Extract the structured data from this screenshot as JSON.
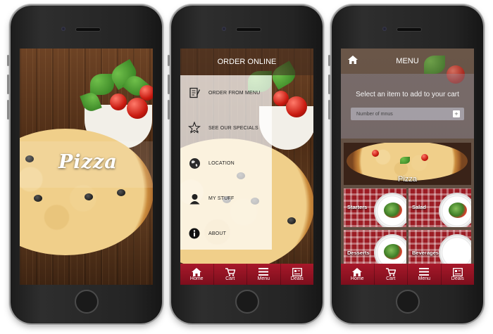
{
  "phone1": {
    "splash_title": "Pizza"
  },
  "phone2": {
    "header_title": "ORDER ONLINE",
    "menu_items": [
      {
        "label": "ORDER FROM MENU",
        "icon": "order-menu-icon"
      },
      {
        "label": "SEE OUR SPECIALS",
        "icon": "stars-icon"
      },
      {
        "label": "LOCATION",
        "icon": "globe-icon"
      },
      {
        "label": "MY STUFF",
        "icon": "user-icon"
      },
      {
        "label": "ABOUT",
        "icon": "info-icon"
      }
    ],
    "tabs": [
      {
        "label": "Home",
        "icon": "home-icon"
      },
      {
        "label": "Cart",
        "icon": "cart-icon"
      },
      {
        "label": "Menu",
        "icon": "hamburger-icon"
      },
      {
        "label": "Deals",
        "icon": "deals-icon"
      }
    ]
  },
  "phone3": {
    "header_title": "MENU",
    "prompt": "Select an item to add to your cart",
    "input_placeholder": "Number of mnus",
    "banner_label": "Pizza",
    "categories": [
      {
        "label": "Starters"
      },
      {
        "label": "Salad"
      },
      {
        "label": "Desserts"
      },
      {
        "label": "Beverages"
      }
    ],
    "tabs": [
      {
        "label": "Home",
        "icon": "home-icon"
      },
      {
        "label": "Cart",
        "icon": "cart-icon"
      },
      {
        "label": "Menu",
        "icon": "hamburger-icon"
      },
      {
        "label": "Deals",
        "icon": "deals-icon"
      }
    ]
  },
  "colors": {
    "tabbar": "#8e1222",
    "tile_red": "#9c1c24"
  }
}
